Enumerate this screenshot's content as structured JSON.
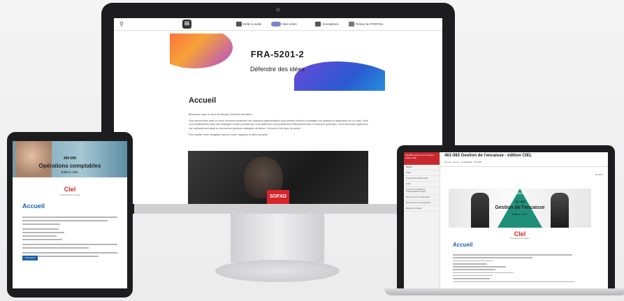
{
  "monitor": {
    "topbar": {
      "items": [
        {
          "label": "Boîte à outils",
          "icon": "toolbox-icon"
        },
        {
          "label": "Mes notes",
          "icon": "toggle-icon"
        },
        {
          "label": "Annotations",
          "icon": "notes-icon"
        },
        {
          "label": "Retour au PORTAIL",
          "icon": "exit-icon"
        }
      ]
    },
    "banner": {
      "code": "FRA-5201-2",
      "subtitle": "Défendre des idées"
    },
    "heading": "Accueil",
    "paragraphs": [
      "Bienvenue dans le cours de français Défendre des idées !",
      "Vous découvrirez dans ce cours comment construire une séquence argumentative pour prendre position et partager vos opinions et arguments sur un sujet. Vous vous familiariserez avec des stratégies et des procédés qui vous aideront à vous positionner efficacement face à n'importe quel enjeu. Vous enrichirez également vos méthodes de travail en découvrant plusieurs stratégies de lecture, d'écoute et de prise de parole.",
      "Pour faciliter votre navigation dans le cours, regardez la vidéo suivante."
    ],
    "video_logo": "SOFAD"
  },
  "tablet": {
    "banner": {
      "code": "460-096",
      "title": "Opérations comptables",
      "edition": "Édition CIEL"
    },
    "logo": "CIel",
    "logo_sub": "Gouvernement en ligne",
    "heading": "Accueil",
    "button": "Poursuivre"
  },
  "laptop": {
    "title": "461-083 Gestion de l'encaisse - édition CIEL",
    "sidebar_head": "461-083 Gestion de l'encaisse - édition CIEL",
    "sidebar_items": [
      "Badges",
      "Notes",
      "Guide d'accessibilité CIEL",
      "Guide",
      "Tout sur les opérations mathématiques en ligne",
      "Ressources pour apprenants",
      "Ressources pour enseignants",
      "Espace de partage"
    ],
    "banner": {
      "result": "RÉSULTATS",
      "code": "461-083",
      "name": "Gestion de l'encaisse",
      "edition": "édition CIEL"
    },
    "logo": "CIel",
    "logo_sub": "Gouvernement en ligne",
    "heading": "Accueil",
    "right_label": "Derniers"
  }
}
